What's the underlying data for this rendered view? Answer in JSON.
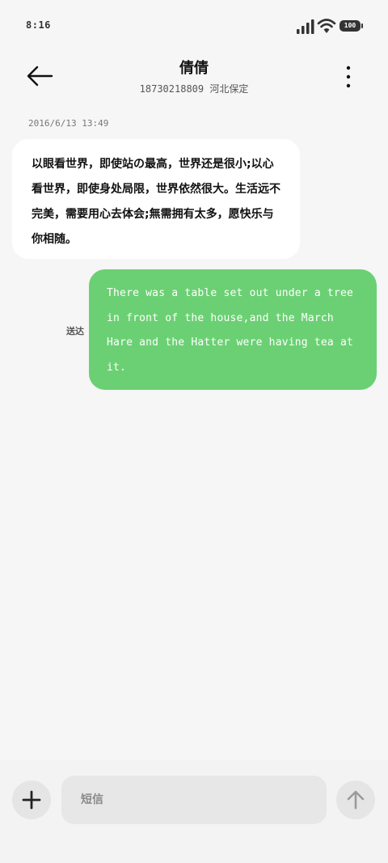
{
  "status_bar": {
    "time": "8:16",
    "battery": "100",
    "icons": [
      "signal-icon",
      "wifi-icon",
      "battery-icon"
    ]
  },
  "header": {
    "title": "倩倩",
    "subtitle": "18730218809 河北保定",
    "icons": [
      "back-arrow-icon",
      "more-vertical-icon"
    ]
  },
  "conversation": {
    "date": "2016/6/13 13:49",
    "incoming_message": "以眼看世界，即使站の最高，世界还是很小;以心看世界，即使身处局限，世界依然很大。生活远不完美，需要用心去体会;無需拥有太多，愿快乐与你相随。",
    "outgoing_message": "There was a table set out under a tree in front of the house,and the March Hare and the Hatter were having tea at it.",
    "sent_status": "送达"
  },
  "composer": {
    "placeholder": "短信",
    "icons": [
      "plus-icon",
      "send-arrow-icon"
    ]
  },
  "colors": {
    "background": "#f6f6f6",
    "incoming_bubble": "#ffffff",
    "outgoing_bubble": "#6bd073",
    "input_bg": "#e7e7e7"
  }
}
